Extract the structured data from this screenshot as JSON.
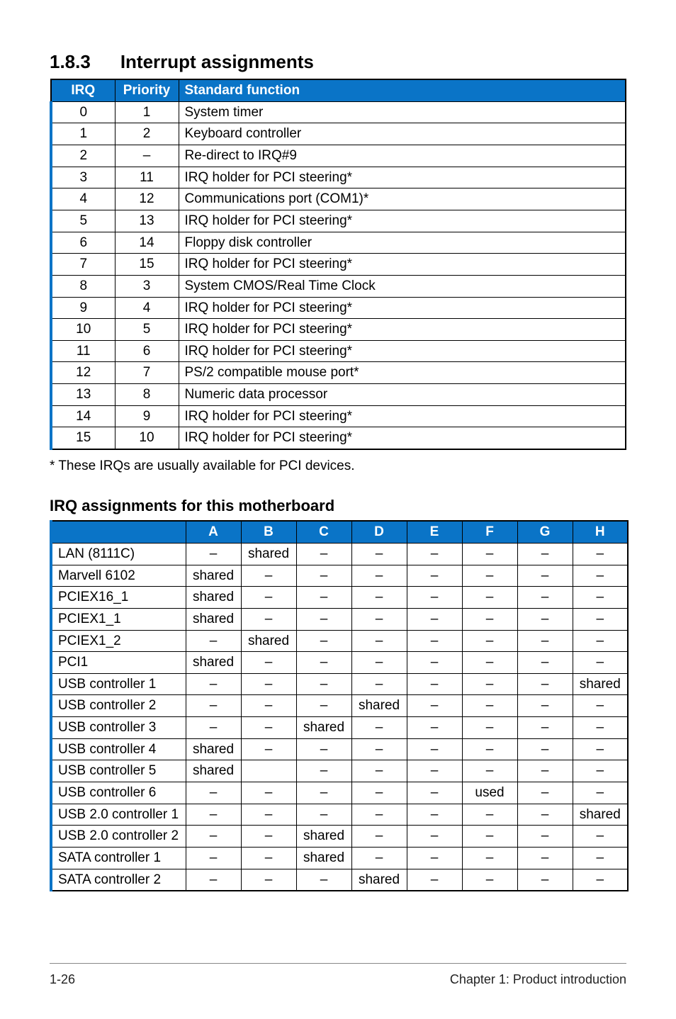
{
  "section": {
    "number": "1.8.3",
    "title": "Interrupt assignments"
  },
  "irq_table": {
    "headers": {
      "irq": "IRQ",
      "priority": "Priority",
      "func": "Standard function"
    },
    "rows": [
      {
        "irq": "0",
        "priority": "1",
        "func": "System timer"
      },
      {
        "irq": "1",
        "priority": "2",
        "func": "Keyboard controller"
      },
      {
        "irq": "2",
        "priority": "–",
        "func": "Re-direct to IRQ#9"
      },
      {
        "irq": "3",
        "priority": "11",
        "func": "IRQ holder for PCI steering*"
      },
      {
        "irq": "4",
        "priority": "12",
        "func": "Communications port (COM1)*"
      },
      {
        "irq": "5",
        "priority": "13",
        "func": "IRQ holder for PCI steering*"
      },
      {
        "irq": "6",
        "priority": "14",
        "func": "Floppy disk controller"
      },
      {
        "irq": "7",
        "priority": "15",
        "func": "IRQ holder for PCI steering*"
      },
      {
        "irq": "8",
        "priority": "3",
        "func": "System CMOS/Real Time Clock"
      },
      {
        "irq": "9",
        "priority": "4",
        "func": "IRQ holder for PCI steering*"
      },
      {
        "irq": "10",
        "priority": "5",
        "func": "IRQ holder for PCI steering*"
      },
      {
        "irq": "11",
        "priority": "6",
        "func": "IRQ holder for PCI steering*"
      },
      {
        "irq": "12",
        "priority": "7",
        "func": "PS/2 compatible mouse port*"
      },
      {
        "irq": "13",
        "priority": "8",
        "func": "Numeric data processor"
      },
      {
        "irq": "14",
        "priority": "9",
        "func": "IRQ holder for PCI steering*"
      },
      {
        "irq": "15",
        "priority": "10",
        "func": "IRQ holder for PCI steering*"
      }
    ]
  },
  "footnote": "* These IRQs are usually available for PCI devices.",
  "assignments": {
    "title": "IRQ assignments for this motherboard",
    "cols": [
      "A",
      "B",
      "C",
      "D",
      "E",
      "F",
      "G",
      "H"
    ],
    "rows": [
      {
        "label": "LAN (8111C)",
        "cells": [
          "–",
          "shared",
          "–",
          "–",
          "–",
          "–",
          "–",
          "–"
        ]
      },
      {
        "label": "Marvell 6102",
        "cells": [
          "shared",
          "–",
          "–",
          "–",
          "–",
          "–",
          "–",
          "–"
        ]
      },
      {
        "label": "PCIEX16_1",
        "cells": [
          "shared",
          "–",
          "–",
          "–",
          "–",
          "–",
          "–",
          "–"
        ]
      },
      {
        "label": "PCIEX1_1",
        "cells": [
          "shared",
          "–",
          "–",
          "–",
          "–",
          "–",
          "–",
          "–"
        ]
      },
      {
        "label": "PCIEX1_2",
        "cells": [
          "–",
          "shared",
          "–",
          "–",
          "–",
          "–",
          "–",
          "–"
        ]
      },
      {
        "label": "PCI1",
        "cells": [
          "shared",
          "–",
          "–",
          "–",
          "–",
          "–",
          "–",
          "–"
        ]
      },
      {
        "label": "USB controller 1",
        "cells": [
          "–",
          "–",
          "–",
          "–",
          "–",
          "–",
          "–",
          "shared"
        ]
      },
      {
        "label": "USB controller 2",
        "cells": [
          "–",
          "–",
          "–",
          "shared",
          "–",
          "–",
          "–",
          "–"
        ]
      },
      {
        "label": "USB controller 3",
        "cells": [
          "–",
          "–",
          "shared",
          "–",
          "–",
          "–",
          "–",
          "–"
        ]
      },
      {
        "label": "USB controller 4",
        "cells": [
          "shared",
          "–",
          "–",
          "–",
          "–",
          "–",
          "–",
          "–"
        ]
      },
      {
        "label": "USB controller 5",
        "cells": [
          "shared",
          "",
          "–",
          "–",
          "–",
          "–",
          "–",
          "–"
        ]
      },
      {
        "label": "USB controller 6",
        "cells": [
          "–",
          "–",
          "–",
          "–",
          "–",
          "used",
          "–",
          "–"
        ]
      },
      {
        "label": "USB 2.0 controller 1",
        "cells": [
          "–",
          "–",
          "–",
          "–",
          "–",
          "–",
          "–",
          "shared"
        ]
      },
      {
        "label": "USB 2.0 controller 2",
        "cells": [
          "–",
          "–",
          "shared",
          "–",
          "–",
          "–",
          "–",
          "–"
        ]
      },
      {
        "label": "SATA controller 1",
        "cells": [
          "–",
          "–",
          "shared",
          "–",
          "–",
          "–",
          "–",
          "–"
        ]
      },
      {
        "label": "SATA controller 2",
        "cells": [
          "–",
          "–",
          "–",
          "shared",
          "–",
          "–",
          "–",
          "–"
        ]
      }
    ]
  },
  "footer": {
    "left": "1-26",
    "right": "Chapter 1: Product introduction"
  }
}
